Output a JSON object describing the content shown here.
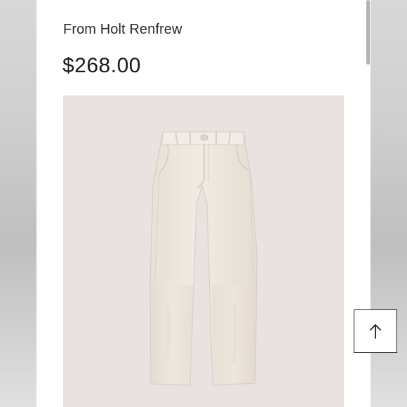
{
  "product": {
    "brand_line": "From Holt Renfrew",
    "price": "$268.00",
    "image_icon": "cream-wide-leg-pants-photo",
    "image_background": "#e8e2e1",
    "garment_color": "#eee7de"
  },
  "controls": {
    "scroll_to_top_icon": "arrow-up-icon"
  }
}
